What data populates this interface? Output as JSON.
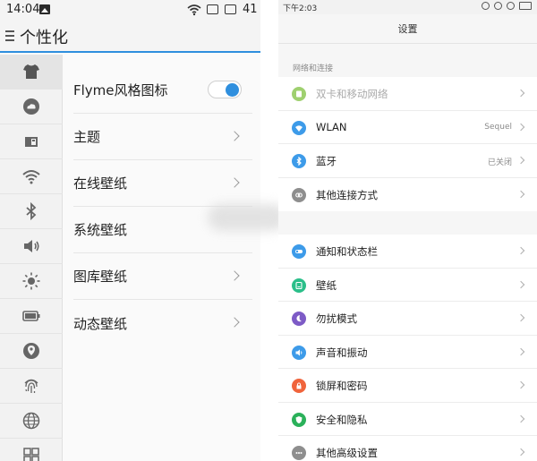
{
  "left": {
    "status": {
      "time": "14:04",
      "battery": "41"
    },
    "title": "个性化",
    "sidebar": [
      {
        "icon": "tshirt-icon",
        "active": true
      },
      {
        "icon": "cloud-icon"
      },
      {
        "icon": "sim-card-icon"
      },
      {
        "icon": "wifi-icon"
      },
      {
        "icon": "bluetooth-icon"
      },
      {
        "icon": "volume-icon"
      },
      {
        "icon": "brightness-icon"
      },
      {
        "icon": "battery-icon"
      },
      {
        "icon": "location-icon"
      },
      {
        "icon": "fingerprint-icon"
      },
      {
        "icon": "globe-icon"
      },
      {
        "icon": "grid-icon"
      }
    ],
    "items": [
      {
        "label": "Flyme风格图标",
        "toggle": true
      },
      {
        "label": "主题"
      },
      {
        "label": "在线壁纸"
      },
      {
        "label": "系统壁纸"
      },
      {
        "label": "图库壁纸"
      },
      {
        "label": "动态壁纸"
      }
    ]
  },
  "right": {
    "status": {
      "time": "下午2:03"
    },
    "title": "设置",
    "section_label": "网络和连接",
    "group1": [
      {
        "label": "双卡和移动网络",
        "dim": true,
        "icon": "sim-icon",
        "color": "#9fd06f"
      },
      {
        "label": "WLAN",
        "value": "Sequel",
        "icon": "wifi-icon",
        "color": "#3d9be9"
      },
      {
        "label": "蓝牙",
        "value": "已关闭",
        "icon": "bluetooth-icon",
        "color": "#3d9be9"
      },
      {
        "label": "其他连接方式",
        "icon": "link-icon",
        "color": "#8e8e8e"
      }
    ],
    "group2": [
      {
        "label": "通知和状态栏",
        "icon": "notification-icon",
        "color": "#3d9be9"
      },
      {
        "label": "壁纸",
        "icon": "wallpaper-icon",
        "color": "#2bbf8a"
      },
      {
        "label": "勿扰模式",
        "icon": "moon-icon",
        "color": "#7d5bc6"
      },
      {
        "label": "声音和振动",
        "icon": "sound-icon",
        "color": "#3d9be9"
      },
      {
        "label": "锁屏和密码",
        "icon": "lock-icon",
        "color": "#f0643c"
      },
      {
        "label": "安全和隐私",
        "icon": "shield-icon",
        "color": "#2bb15a"
      },
      {
        "label": "其他高级设置",
        "icon": "more-icon",
        "color": "#8e8e8e"
      }
    ]
  }
}
